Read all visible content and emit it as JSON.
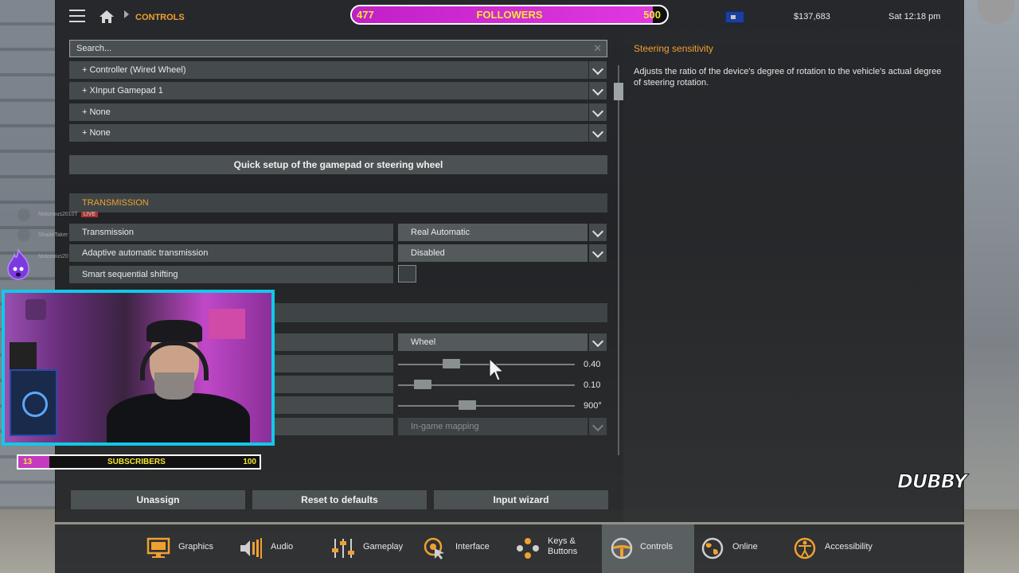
{
  "header": {
    "breadcrumb": "CONTROLS",
    "money": "$137,683",
    "clock": "Sat 12:18 pm"
  },
  "followers": {
    "current": "477",
    "label": "FOLLOWERS",
    "goal": "500",
    "progress": 0.954
  },
  "search": {
    "placeholder": "Search..."
  },
  "devices": [
    "+ Controller (Wired Wheel)",
    "+ XInput Gamepad 1",
    "+ None",
    "+ None"
  ],
  "quick_setup_label": "Quick setup of the gamepad or steering wheel",
  "transmission": {
    "heading": "TRANSMISSION",
    "rows": [
      {
        "label": "Transmission",
        "value": "Real Automatic"
      },
      {
        "label": "Adaptive automatic transmission",
        "value": "Disabled"
      },
      {
        "label": "Smart sequential shifting",
        "checked": false
      }
    ]
  },
  "steering": {
    "mode_value": "Wheel",
    "sliders": [
      {
        "value_text": "0.40",
        "position": 0.28
      },
      {
        "value_text": "0.10",
        "position": 0.1
      },
      {
        "value_text": "900°",
        "position": 0.38
      }
    ],
    "mapping_value": "In-game mapping"
  },
  "buttons": {
    "unassign": "Unassign",
    "reset": "Reset to defaults",
    "wizard": "Input wizard"
  },
  "description": {
    "title": "Steering sensitivity",
    "text": "Adjusts the ratio of the device's degree of rotation to the vehicle's actual degree of steering rotation."
  },
  "nav": [
    {
      "label": "Graphics",
      "icon": "monitor-icon"
    },
    {
      "label": "Audio",
      "icon": "speaker-icon"
    },
    {
      "label": "Gameplay",
      "icon": "sliders-icon"
    },
    {
      "label": "Interface",
      "icon": "cursor-click-icon"
    },
    {
      "label": "Keys &\nButtons",
      "icon": "buttons-icon"
    },
    {
      "label": "Controls",
      "icon": "steering-wheel-icon",
      "active": true
    },
    {
      "label": "Online",
      "icon": "globe-icon"
    },
    {
      "label": "Accessibility",
      "icon": "accessibility-icon"
    }
  ],
  "overlay": {
    "chat": [
      "Notorious2010T",
      "ShadeTaker",
      "Notorious20"
    ],
    "live_badge": "LIVE",
    "subs_current": "13",
    "subs_label": "SUBSCRIBERS",
    "subs_goal": "100",
    "subs_progress": 0.13,
    "brand": "DUBBY"
  },
  "colors": {
    "accent": "#f0a030",
    "webcam_border": "#12c8e8",
    "followers_fill": "#e038e0"
  }
}
